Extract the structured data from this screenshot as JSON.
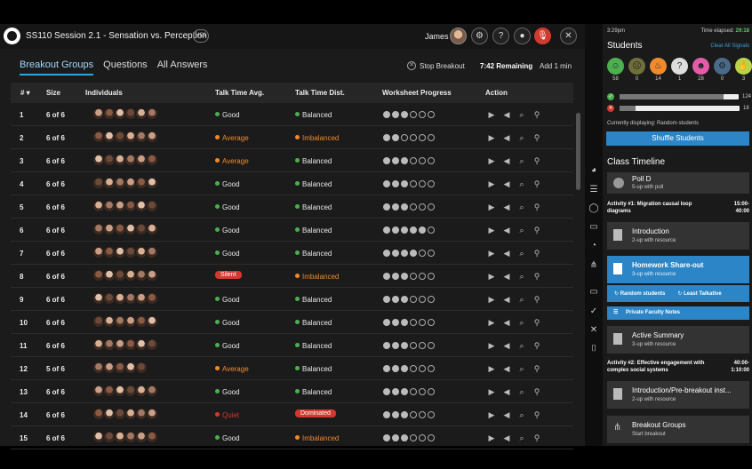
{
  "header": {
    "title": "SS110 Session 2.1 - Sensation vs. Perception",
    "badge": "HC1",
    "user": "James",
    "help": "?",
    "close": "✕"
  },
  "tabs": [
    {
      "label": "Breakout Groups",
      "active": true
    },
    {
      "label": "Questions",
      "active": false
    },
    {
      "label": "All Answers",
      "active": false
    }
  ],
  "breakout": {
    "stop_label": "Stop Breakout",
    "remaining": "7:42 Remaining",
    "add_label": "Add 1 min"
  },
  "table": {
    "columns": [
      "#",
      "Size",
      "Individuals",
      "Talk Time Avg.",
      "Talk Time Dist.",
      "Worksheet Progress",
      "Action"
    ],
    "rows": [
      {
        "num": "1",
        "size": "6 of 6",
        "faces": 6,
        "avg": "Good",
        "avg_kind": "good",
        "dist": "Balanced",
        "dist_kind": "good",
        "progress": 3
      },
      {
        "num": "2",
        "size": "6 of 6",
        "faces": 6,
        "avg": "Average",
        "avg_kind": "warn",
        "dist": "Imbalanced",
        "dist_kind": "warn",
        "progress": 2
      },
      {
        "num": "3",
        "size": "6 of 6",
        "faces": 6,
        "avg": "Average",
        "avg_kind": "warn",
        "dist": "Balanced",
        "dist_kind": "good",
        "progress": 3
      },
      {
        "num": "4",
        "size": "6 of 6",
        "faces": 6,
        "avg": "Good",
        "avg_kind": "good",
        "dist": "Balanced",
        "dist_kind": "good",
        "progress": 3
      },
      {
        "num": "5",
        "size": "6 of 6",
        "faces": 6,
        "avg": "Good",
        "avg_kind": "good",
        "dist": "Balanced",
        "dist_kind": "good",
        "progress": 3
      },
      {
        "num": "6",
        "size": "6 of 6",
        "faces": 6,
        "avg": "Good",
        "avg_kind": "good",
        "dist": "Balanced",
        "dist_kind": "good",
        "progress": 5
      },
      {
        "num": "7",
        "size": "6 of 6",
        "faces": 6,
        "avg": "Good",
        "avg_kind": "good",
        "dist": "Balanced",
        "dist_kind": "good",
        "progress": 4
      },
      {
        "num": "8",
        "size": "6 of 6",
        "faces": 6,
        "avg": "Silent",
        "avg_kind": "pill",
        "dist": "Imbalanced",
        "dist_kind": "warn",
        "progress": 3
      },
      {
        "num": "9",
        "size": "6 of 6",
        "faces": 6,
        "avg": "Good",
        "avg_kind": "good",
        "dist": "Balanced",
        "dist_kind": "good",
        "progress": 3
      },
      {
        "num": "10",
        "size": "6 of 6",
        "faces": 6,
        "avg": "Good",
        "avg_kind": "good",
        "dist": "Balanced",
        "dist_kind": "good",
        "progress": 3
      },
      {
        "num": "11",
        "size": "6 of 6",
        "faces": 6,
        "avg": "Good",
        "avg_kind": "good",
        "dist": "Balanced",
        "dist_kind": "good",
        "progress": 3
      },
      {
        "num": "12",
        "size": "5 of 6",
        "faces": 5,
        "avg": "Average",
        "avg_kind": "warn",
        "dist": "Balanced",
        "dist_kind": "good",
        "progress": 3
      },
      {
        "num": "13",
        "size": "6 of 6",
        "faces": 6,
        "avg": "Good",
        "avg_kind": "good",
        "dist": "Balanced",
        "dist_kind": "good",
        "progress": 3
      },
      {
        "num": "14",
        "size": "6 of 6",
        "faces": 6,
        "avg": "Quiet",
        "avg_kind": "bad",
        "dist": "Dominated",
        "dist_kind": "pill",
        "progress": 3
      },
      {
        "num": "15",
        "size": "6 of 6",
        "faces": 6,
        "avg": "Good",
        "avg_kind": "good",
        "dist": "Imbalanced",
        "dist_kind": "warn",
        "progress": 3
      }
    ]
  },
  "panel": {
    "clock": "3:29pm",
    "elapsed_label": "Time elapsed:",
    "elapsed": "29:18",
    "students_title": "Students",
    "clear_label": "Clear All Signals",
    "signals": [
      {
        "icon": "smile-icon",
        "glyph": "☺",
        "color": "#4caf50",
        "count": "58"
      },
      {
        "icon": "neutral-icon",
        "glyph": "☹",
        "color": "#6f6f3a",
        "count": "0"
      },
      {
        "icon": "fire-icon",
        "glyph": "♨",
        "color": "#f08a2c",
        "count": "14"
      },
      {
        "icon": "confused-icon",
        "glyph": "?",
        "color": "#dddddd",
        "count": "1"
      },
      {
        "icon": "laugh-icon",
        "glyph": "☻",
        "color": "#e45ca8",
        "count": "28"
      },
      {
        "icon": "robot-icon",
        "glyph": "⚙",
        "color": "#4a6a8a",
        "count": "0"
      },
      {
        "icon": "hand-icon",
        "glyph": "✋",
        "color": "#b7d44a",
        "count": "3"
      }
    ],
    "bars": [
      {
        "icon": "check-circle-icon",
        "glyph": "✓",
        "color": "#4caf50",
        "count": "124",
        "fraction": 0.87
      },
      {
        "icon": "x-circle-icon",
        "glyph": "✕",
        "color": "#d23a2f",
        "count": "18",
        "fraction": 0.13
      }
    ],
    "displaying": "Currently displaying: Random students",
    "shuffle_label": "Shuffle Students",
    "timeline_title": "Class Timeline",
    "poll": {
      "title": "Poll D",
      "sub": "5-up with poll"
    },
    "activity1": {
      "title": "Activity #1: Migration causal loop diagrams",
      "time": "15:00-\n40:00"
    },
    "intro": {
      "title": "Introduction",
      "sub": "2-up with resource"
    },
    "homework": {
      "title": "Homework Share-out",
      "sub": "3-up with resource"
    },
    "random_label": "Random students",
    "least_label": "Least Talkative",
    "notes_label": "Private Faculty Notes",
    "summary": {
      "title": "Active Summary",
      "sub": "3-up with resource"
    },
    "activity2": {
      "title": "Activity #2: Effective engagement with complex social systems",
      "time": "40:00-\n1:10:00"
    },
    "intro2": {
      "title": "Introduction/Pre-breakout inst...",
      "sub": "2-up with resource"
    },
    "breakouts": {
      "title": "Breakout Groups",
      "sub": "Start breakout"
    }
  },
  "colors": {
    "accent": "#2b85c6",
    "good": "#4caf50",
    "warn": "#f08a2c",
    "bad": "#d23a2f"
  }
}
